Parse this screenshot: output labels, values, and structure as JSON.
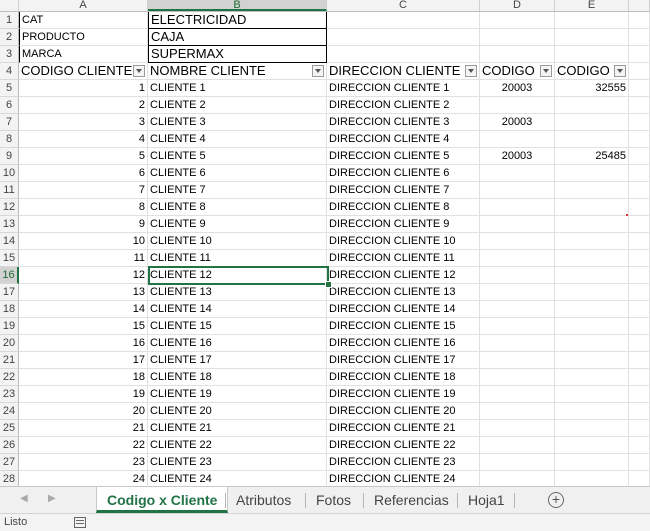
{
  "columns": [
    "A",
    "B",
    "C",
    "D",
    "E"
  ],
  "selected_column": "B",
  "selected_row": "16",
  "header_rows": [
    {
      "row": "1",
      "label": "CAT",
      "value": "ELECTRICIDAD"
    },
    {
      "row": "2",
      "label": "PRODUCTO",
      "value": "CAJA"
    },
    {
      "row": "3",
      "label": "MARCA",
      "value": "SUPERMAX"
    }
  ],
  "table_header": {
    "row": "4",
    "cols": [
      "CODIGO CLIENTE",
      "NOMBRE CLIENTE",
      "DIRECCION CLIENTE",
      "CODIGO",
      "CODIGO"
    ]
  },
  "rows": [
    {
      "row": "5",
      "a": "1",
      "b": "CLIENTE 1",
      "c": "DIRECCION CLIENTE 1",
      "d": "20003",
      "e": "32555"
    },
    {
      "row": "6",
      "a": "2",
      "b": "CLIENTE 2",
      "c": "DIRECCION CLIENTE 2",
      "d": "",
      "e": ""
    },
    {
      "row": "7",
      "a": "3",
      "b": "CLIENTE 3",
      "c": "DIRECCION CLIENTE 3",
      "d": "20003",
      "e": ""
    },
    {
      "row": "8",
      "a": "4",
      "b": "CLIENTE 4",
      "c": "DIRECCION CLIENTE 4",
      "d": "",
      "e": ""
    },
    {
      "row": "9",
      "a": "5",
      "b": "CLIENTE 5",
      "c": "DIRECCION CLIENTE 5",
      "d": "20003",
      "e": "25485"
    },
    {
      "row": "10",
      "a": "6",
      "b": "CLIENTE 6",
      "c": "DIRECCION CLIENTE 6",
      "d": "",
      "e": ""
    },
    {
      "row": "11",
      "a": "7",
      "b": "CLIENTE 7",
      "c": "DIRECCION CLIENTE 7",
      "d": "",
      "e": ""
    },
    {
      "row": "12",
      "a": "8",
      "b": "CLIENTE 8",
      "c": "DIRECCION CLIENTE 8",
      "d": "",
      "e": ""
    },
    {
      "row": "13",
      "a": "9",
      "b": "CLIENTE 9",
      "c": "DIRECCION CLIENTE 9",
      "d": "",
      "e": ""
    },
    {
      "row": "14",
      "a": "10",
      "b": "CLIENTE 10",
      "c": "DIRECCION CLIENTE 10",
      "d": "",
      "e": ""
    },
    {
      "row": "15",
      "a": "11",
      "b": "CLIENTE 11",
      "c": "DIRECCION CLIENTE 11",
      "d": "",
      "e": ""
    },
    {
      "row": "16",
      "a": "12",
      "b": "CLIENTE 12",
      "c": "DIRECCION CLIENTE 12",
      "d": "",
      "e": ""
    },
    {
      "row": "17",
      "a": "13",
      "b": "CLIENTE 13",
      "c": "DIRECCION CLIENTE 13",
      "d": "",
      "e": ""
    },
    {
      "row": "18",
      "a": "14",
      "b": "CLIENTE 14",
      "c": "DIRECCION CLIENTE 14",
      "d": "",
      "e": ""
    },
    {
      "row": "19",
      "a": "15",
      "b": "CLIENTE 15",
      "c": "DIRECCION CLIENTE 15",
      "d": "",
      "e": ""
    },
    {
      "row": "20",
      "a": "16",
      "b": "CLIENTE 16",
      "c": "DIRECCION CLIENTE 16",
      "d": "",
      "e": ""
    },
    {
      "row": "21",
      "a": "17",
      "b": "CLIENTE 17",
      "c": "DIRECCION CLIENTE 17",
      "d": "",
      "e": ""
    },
    {
      "row": "22",
      "a": "18",
      "b": "CLIENTE 18",
      "c": "DIRECCION CLIENTE 18",
      "d": "",
      "e": ""
    },
    {
      "row": "23",
      "a": "19",
      "b": "CLIENTE 19",
      "c": "DIRECCION CLIENTE 19",
      "d": "",
      "e": ""
    },
    {
      "row": "24",
      "a": "20",
      "b": "CLIENTE 20",
      "c": "DIRECCION CLIENTE 20",
      "d": "",
      "e": ""
    },
    {
      "row": "25",
      "a": "21",
      "b": "CLIENTE 21",
      "c": "DIRECCION CLIENTE 21",
      "d": "",
      "e": ""
    },
    {
      "row": "26",
      "a": "22",
      "b": "CLIENTE 22",
      "c": "DIRECCION CLIENTE 22",
      "d": "",
      "e": ""
    },
    {
      "row": "27",
      "a": "23",
      "b": "CLIENTE 23",
      "c": "DIRECCION CLIENTE 23",
      "d": "",
      "e": ""
    },
    {
      "row": "28",
      "a": "24",
      "b": "CLIENTE 24",
      "c": "DIRECCION CLIENTE 24",
      "d": "",
      "e": ""
    }
  ],
  "sheet_tabs": [
    "Codigo x Cliente",
    "Atributos",
    "Fotos",
    "Referencias",
    "Hoja1"
  ],
  "active_tab": "Codigo x Cliente",
  "status_text": "Listo",
  "icons": {
    "nav_prev": "chevron-left-icon",
    "nav_next": "chevron-right-icon",
    "add_sheet": "plus-circle-icon",
    "filter": "filter-dropdown-icon",
    "macro": "macro-record-icon"
  },
  "colors": {
    "accent": "#217346"
  }
}
